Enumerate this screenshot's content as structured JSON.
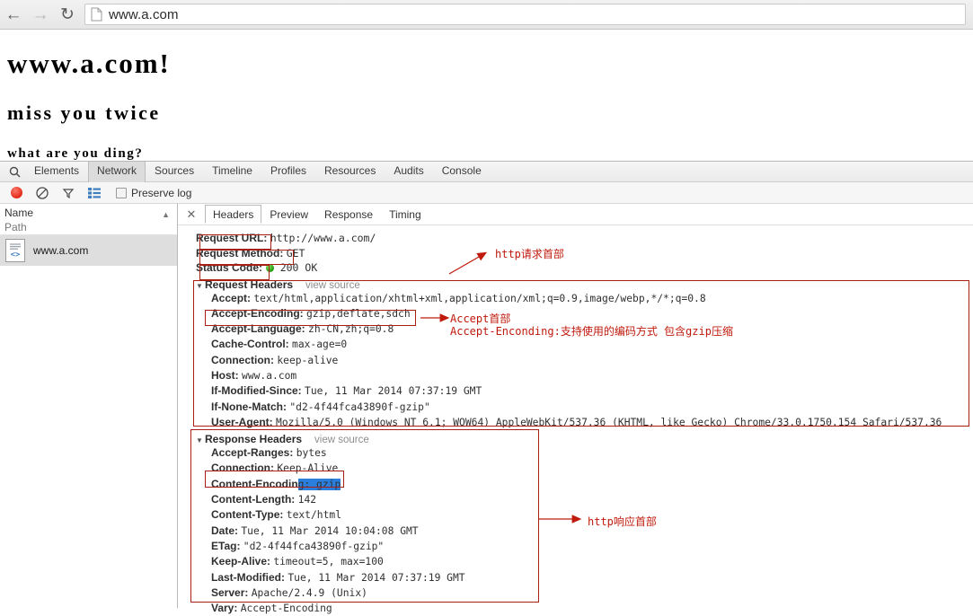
{
  "browser": {
    "back_icon": "back-arrow-icon",
    "forward_icon": "forward-arrow-icon",
    "reload_icon": "reload-icon",
    "page_icon": "document-icon",
    "url": "www.a.com"
  },
  "page": {
    "heading1": "www.a.com!",
    "heading2": "miss you twice",
    "paragraph": "what are you ding?"
  },
  "devtools": {
    "search_icon": "search-icon",
    "tabs": [
      {
        "label": "Elements",
        "active": false
      },
      {
        "label": "Network",
        "active": true
      },
      {
        "label": "Sources",
        "active": false
      },
      {
        "label": "Timeline",
        "active": false
      },
      {
        "label": "Profiles",
        "active": false
      },
      {
        "label": "Resources",
        "active": false
      },
      {
        "label": "Audits",
        "active": false
      },
      {
        "label": "Console",
        "active": false
      }
    ],
    "toolbar": {
      "record_icon": "record-button-icon",
      "clear_icon": "clear-prohibited-icon",
      "filter_icon": "filter-funnel-icon",
      "group_icon": "list-view-icon",
      "preserve_log_label": "Preserve log",
      "preserve_log_checked": false
    },
    "sidebar": {
      "col_name": "Name",
      "col_path": "Path",
      "sort_icon": "sort-ascending-icon",
      "rows": [
        {
          "icon": "source-code-document-icon",
          "label": "www.a.com"
        }
      ]
    },
    "detail": {
      "close_icon": "close-icon",
      "tabs": [
        {
          "label": "Headers",
          "active": true
        },
        {
          "label": "Preview",
          "active": false
        },
        {
          "label": "Response",
          "active": false
        },
        {
          "label": "Timing",
          "active": false
        }
      ],
      "general": [
        {
          "key": "Request URL:",
          "value": "http://www.a.com/"
        },
        {
          "key": "Request Method:",
          "value": "GET"
        },
        {
          "key": "Status Code:",
          "value": "200 OK",
          "status_dot": "green-status-dot"
        }
      ],
      "request_headers": {
        "title": "Request Headers",
        "arrow": "collapse-triangle-icon",
        "view_source": "view source",
        "lines": [
          {
            "key": "Accept:",
            "value": "text/html,application/xhtml+xml,application/xml;q=0.9,image/webp,*/*;q=0.8"
          },
          {
            "key": "Accept-Encoding:",
            "value": "gzip,deflate,sdch"
          },
          {
            "key": "Accept-Language:",
            "value": "zh-CN,zh;q=0.8"
          },
          {
            "key": "Cache-Control:",
            "value": "max-age=0"
          },
          {
            "key": "Connection:",
            "value": "keep-alive"
          },
          {
            "key": "Host:",
            "value": "www.a.com"
          },
          {
            "key": "If-Modified-Since:",
            "value": "Tue, 11 Mar 2014 07:37:19 GMT"
          },
          {
            "key": "If-None-Match:",
            "value": "\"d2-4f44fca43890f-gzip\""
          },
          {
            "key": "User-Agent:",
            "value": "Mozilla/5.0 (Windows NT 6.1; WOW64) AppleWebKit/537.36 (KHTML, like Gecko) Chrome/33.0.1750.154 Safari/537.36"
          }
        ]
      },
      "response_headers": {
        "title": "Response Headers",
        "arrow": "collapse-triangle-icon",
        "view_source": "view source",
        "lines": [
          {
            "key": "Accept-Ranges:",
            "value": "bytes"
          },
          {
            "key": "Connection:",
            "value": "Keep-Alive"
          },
          {
            "key": "Content-Encodin",
            "value": "g: gzip",
            "selected": true
          },
          {
            "key": "Content-Length:",
            "value": "142"
          },
          {
            "key": "Content-Type:",
            "value": "text/html"
          },
          {
            "key": "Date:",
            "value": "Tue, 11 Mar 2014 10:04:08 GMT"
          },
          {
            "key": "ETag:",
            "value": "\"d2-4f44fca43890f-gzip\""
          },
          {
            "key": "Keep-Alive:",
            "value": "timeout=5, max=100"
          },
          {
            "key": "Last-Modified:",
            "value": "Tue, 11 Mar 2014 07:37:19 GMT"
          },
          {
            "key": "Server:",
            "value": "Apache/2.4.9 (Unix)"
          },
          {
            "key": "Vary:",
            "value": "Accept-Encoding"
          }
        ]
      }
    }
  },
  "annotations": {
    "accent_color": "#c01a0c",
    "box_color": "#a81f14",
    "label_request": "http请求首部",
    "label_response": "http响应首部",
    "label_accept_1": "Accept首部",
    "label_accept_2": "Accept-Enconding:支持使用的编码方式 包含gzip压缩"
  }
}
